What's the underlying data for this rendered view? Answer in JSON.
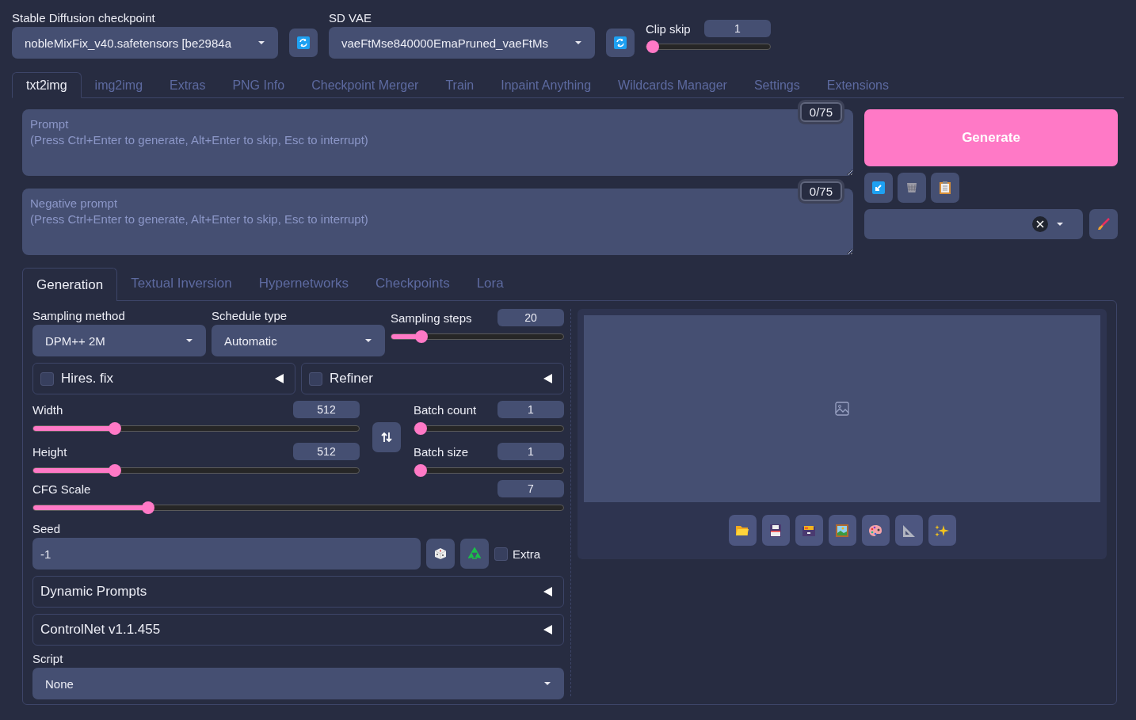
{
  "checkpoint": {
    "label": "Stable Diffusion checkpoint",
    "value": "nobleMixFix_v40.safetensors [be2984a"
  },
  "vae": {
    "label": "SD VAE",
    "value": "vaeFtMse840000EmaPruned_vaeFtMs"
  },
  "clip_skip": {
    "label": "Clip skip",
    "value": "1",
    "level": 0
  },
  "tabs": [
    {
      "label": "txt2img",
      "selected": true
    },
    {
      "label": "img2img",
      "selected": false
    },
    {
      "label": "Extras",
      "selected": false
    },
    {
      "label": "PNG Info",
      "selected": false
    },
    {
      "label": "Checkpoint Merger",
      "selected": false
    },
    {
      "label": "Train",
      "selected": false
    },
    {
      "label": "Inpaint Anything",
      "selected": false
    },
    {
      "label": "Wildcards Manager",
      "selected": false
    },
    {
      "label": "Settings",
      "selected": false
    },
    {
      "label": "Extensions",
      "selected": false
    }
  ],
  "prompt": {
    "placeholder": "Prompt\n(Press Ctrl+Enter to generate, Alt+Enter to skip, Esc to interrupt)",
    "token_count": "0/75"
  },
  "negative_prompt": {
    "placeholder": "Negative prompt\n(Press Ctrl+Enter to generate, Alt+Enter to skip, Esc to interrupt)",
    "token_count": "0/75"
  },
  "generate_button": "Generate",
  "subtabs": [
    {
      "label": "Generation",
      "selected": true
    },
    {
      "label": "Textual Inversion",
      "selected": false
    },
    {
      "label": "Hypernetworks",
      "selected": false
    },
    {
      "label": "Checkpoints",
      "selected": false
    },
    {
      "label": "Lora",
      "selected": false
    }
  ],
  "sampling_method": {
    "label": "Sampling method",
    "value": "DPM++ 2M"
  },
  "schedule_type": {
    "label": "Schedule type",
    "value": "Automatic"
  },
  "sampling_steps": {
    "label": "Sampling steps",
    "value": "20",
    "level": 0.15
  },
  "accordions_top": [
    {
      "label": "Hires. fix",
      "checked": false
    },
    {
      "label": "Refiner",
      "checked": false
    }
  ],
  "width": {
    "label": "Width",
    "value": "512",
    "level": 0.24
  },
  "height": {
    "label": "Height",
    "value": "512",
    "level": 0.24
  },
  "batch_count": {
    "label": "Batch count",
    "value": "1",
    "level": 0
  },
  "batch_size": {
    "label": "Batch size",
    "value": "1",
    "level": 0
  },
  "cfg_scale": {
    "label": "CFG Scale",
    "value": "7",
    "level": 0.21
  },
  "seed": {
    "label": "Seed",
    "value": "-1"
  },
  "extra": {
    "label": "Extra",
    "checked": false
  },
  "accordions_bottom": [
    {
      "label": "Dynamic Prompts",
      "expanded": false
    },
    {
      "label": "ControlNet v1.1.455",
      "expanded": false
    }
  ],
  "script": {
    "label": "Script",
    "value": "None"
  }
}
